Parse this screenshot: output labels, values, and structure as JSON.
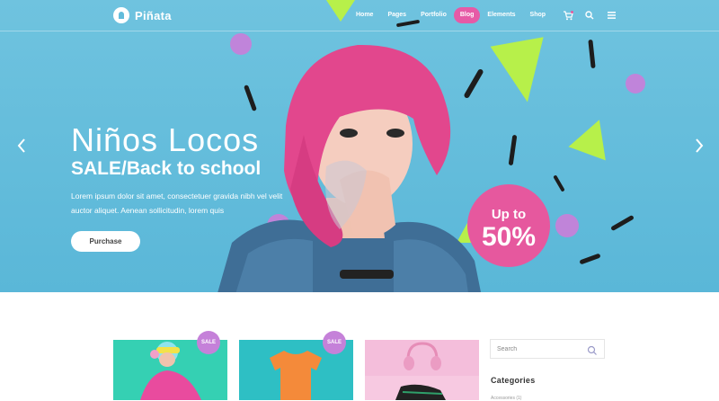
{
  "brand": {
    "name": "Piñata"
  },
  "nav": {
    "items": [
      {
        "label": "Home"
      },
      {
        "label": "Pages"
      },
      {
        "label": "Portfolio"
      },
      {
        "label": "Blog"
      },
      {
        "label": "Elements"
      },
      {
        "label": "Shop"
      }
    ],
    "active": "Blog",
    "icons": [
      "cart-icon",
      "search-icon",
      "menu-icon"
    ]
  },
  "hero": {
    "title": "Niños Locos",
    "subtitle": "SALE/Back to school",
    "description": "Lorem ipsum dolor sit amet, consectetuer gravida nibh vel velit auctor aliquet. Aenean sollicitudin, lorem quis",
    "button": "Purchase",
    "promo_up_to": "Up to",
    "promo_percent": "50%"
  },
  "products": [
    {
      "badge": "SALE"
    },
    {
      "badge": "SALE"
    },
    {
      "badge": ""
    }
  ],
  "sidebar": {
    "search_placeholder": "Search",
    "categories_title": "Categories",
    "first_category": "Accessories (1)"
  },
  "colors": {
    "hero_bg": "#62bcdb",
    "accent_pink": "#e6589e",
    "accent_purple": "#c581d9",
    "accent_lime": "#b7f04a"
  }
}
